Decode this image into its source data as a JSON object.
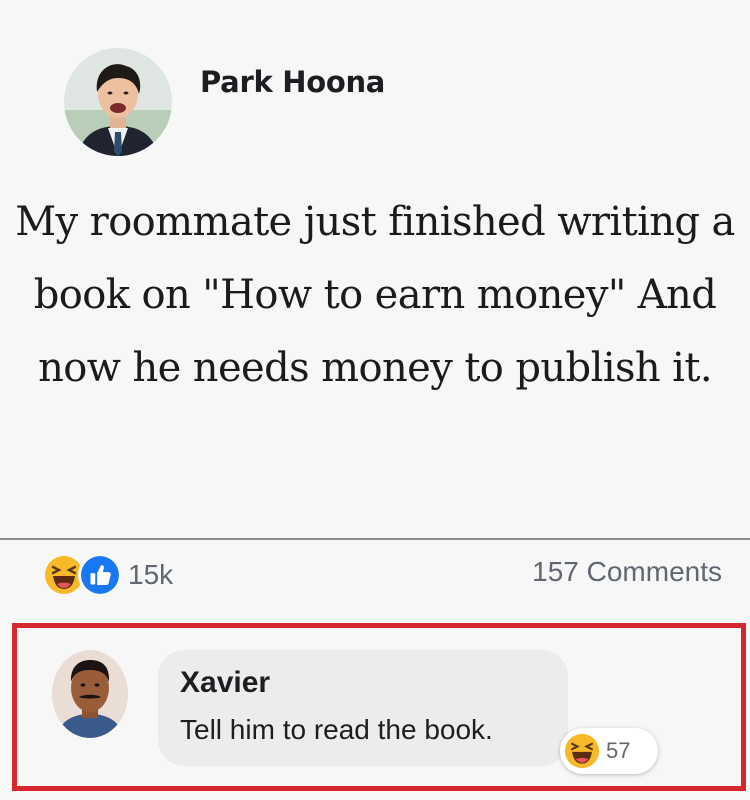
{
  "post": {
    "author": "Park Hoona",
    "text": "My roommate just finished writing a book on \"How to earn money\" And now he needs money to publish it."
  },
  "reactions": {
    "icons": [
      "haha-icon",
      "like-icon"
    ],
    "count": "15k",
    "comments": "157 Comments"
  },
  "comment": {
    "author": "Xavier",
    "text": "Tell him to read the book.",
    "reaction_icon": "haha-icon",
    "reaction_count": "57"
  },
  "colors": {
    "highlight_border": "#d6272e",
    "like_blue": "#1877f2",
    "haha_yellow": "#f7b928",
    "bubble_gray": "#ececed"
  }
}
